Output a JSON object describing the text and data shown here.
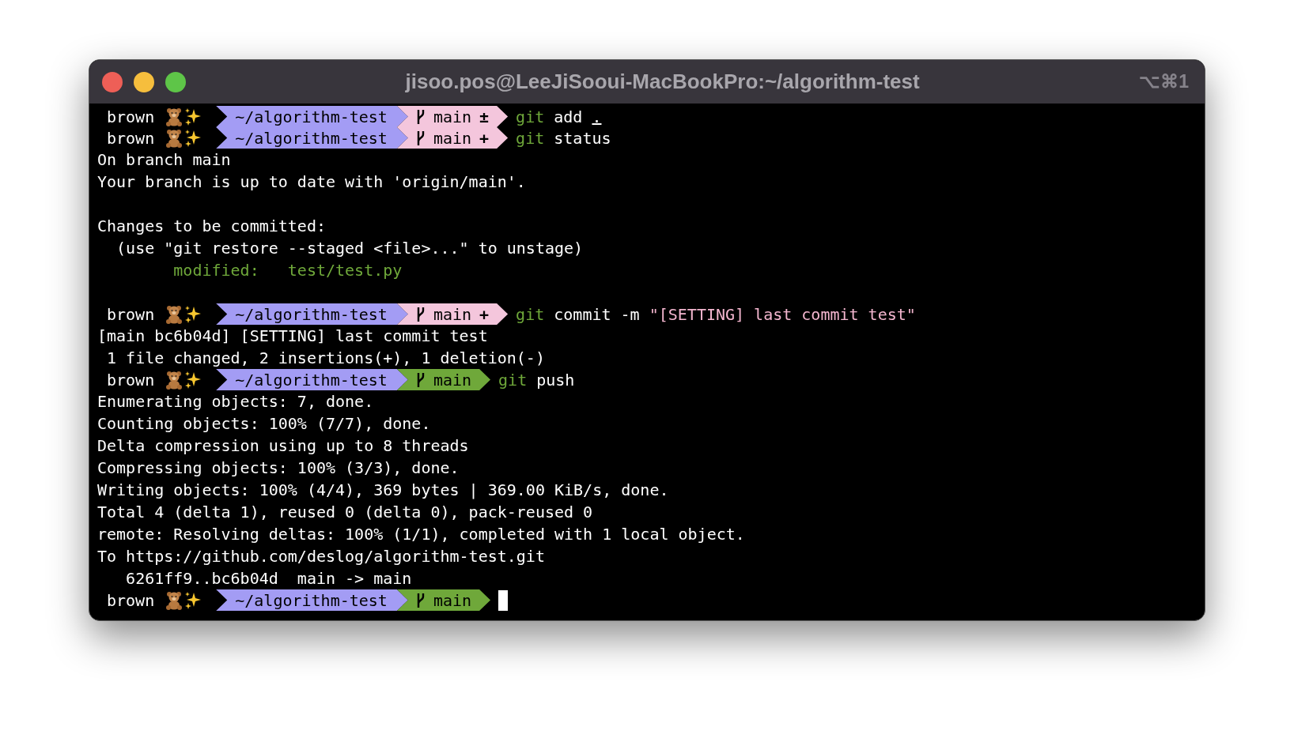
{
  "window": {
    "title": "jisoo.pos@LeeJiSooui-MacBookPro:~/algorithm-test",
    "shortcut": "⌥⌘1"
  },
  "lines": [
    {
      "kind": "prompt",
      "user": "brown",
      "path": "~/algorithm-test",
      "branch": "main",
      "status": "±",
      "clean": false,
      "cursor": false,
      "command": [
        {
          "kind": "git",
          "text": "git"
        },
        {
          "kind": "plain",
          "text": " add "
        },
        {
          "kind": "underlined",
          "text": "."
        }
      ]
    },
    {
      "kind": "prompt",
      "user": "brown",
      "path": "~/algorithm-test",
      "branch": "main",
      "status": "+",
      "clean": false,
      "cursor": false,
      "command": [
        {
          "kind": "git",
          "text": "git"
        },
        {
          "kind": "plain",
          "text": " status"
        }
      ]
    },
    {
      "kind": "output",
      "highlighted": false,
      "text": "On branch main"
    },
    {
      "kind": "output",
      "highlighted": false,
      "text": "Your branch is up to date with 'origin/main'."
    },
    {
      "kind": "blank"
    },
    {
      "kind": "output",
      "highlighted": false,
      "text": "Changes to be committed:"
    },
    {
      "kind": "output",
      "highlighted": false,
      "text": "  (use \"git restore --staged <file>...\" to unstage)"
    },
    {
      "kind": "output",
      "highlighted": true,
      "text": "        modified:   test/test.py"
    },
    {
      "kind": "blank"
    },
    {
      "kind": "prompt",
      "user": "brown",
      "path": "~/algorithm-test",
      "branch": "main",
      "status": "+",
      "clean": false,
      "cursor": false,
      "command": [
        {
          "kind": "git",
          "text": "git"
        },
        {
          "kind": "plain",
          "text": " commit -m "
        },
        {
          "kind": "string",
          "text": "\"[SETTING] last commit test\""
        }
      ]
    },
    {
      "kind": "output",
      "highlighted": false,
      "text": "[main bc6b04d] [SETTING] last commit test"
    },
    {
      "kind": "output",
      "highlighted": false,
      "text": " 1 file changed, 2 insertions(+), 1 deletion(-)"
    },
    {
      "kind": "prompt",
      "user": "brown",
      "path": "~/algorithm-test",
      "branch": "main",
      "clean": true,
      "cursor": false,
      "command": [
        {
          "kind": "git",
          "text": "git"
        },
        {
          "kind": "plain",
          "text": " push"
        }
      ]
    },
    {
      "kind": "output",
      "highlighted": false,
      "text": "Enumerating objects: 7, done."
    },
    {
      "kind": "output",
      "highlighted": false,
      "text": "Counting objects: 100% (7/7), done."
    },
    {
      "kind": "output",
      "highlighted": false,
      "text": "Delta compression using up to 8 threads"
    },
    {
      "kind": "output",
      "highlighted": false,
      "text": "Compressing objects: 100% (3/3), done."
    },
    {
      "kind": "output",
      "highlighted": false,
      "text": "Writing objects: 100% (4/4), 369 bytes | 369.00 KiB/s, done."
    },
    {
      "kind": "output",
      "highlighted": false,
      "text": "Total 4 (delta 1), reused 0 (delta 0), pack-reused 0"
    },
    {
      "kind": "output",
      "highlighted": false,
      "text": "remote: Resolving deltas: 100% (1/1), completed with 1 local object."
    },
    {
      "kind": "output",
      "highlighted": false,
      "text": "To https://github.com/deslog/algorithm-test.git"
    },
    {
      "kind": "output",
      "highlighted": false,
      "text": "   6261ff9..bc6b04d  main -> main"
    },
    {
      "kind": "prompt",
      "user": "brown",
      "path": "~/algorithm-test",
      "branch": "main",
      "clean": true,
      "cursor": true
    }
  ]
}
